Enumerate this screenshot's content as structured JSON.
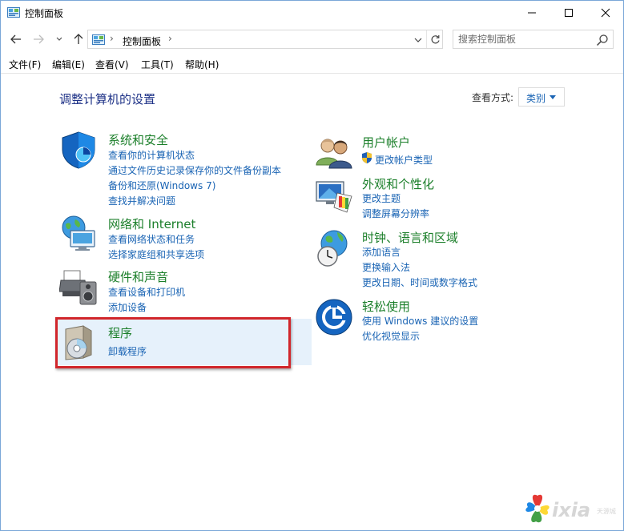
{
  "window": {
    "title": "控制面板"
  },
  "address": {
    "location": "控制面板"
  },
  "search": {
    "placeholder": "搜索控制面板"
  },
  "menu": [
    "文件(F)",
    "编辑(E)",
    "查看(V)",
    "工具(T)",
    "帮助(H)"
  ],
  "content": {
    "heading": "调整计算机的设置",
    "view_by_label": "查看方式:",
    "view_by_value": "类别"
  },
  "categories_left": [
    {
      "title": "系统和安全",
      "icon": "shield-icon",
      "links": [
        "查看你的计算机状态",
        "通过文件历史记录保存你的文件备份副本",
        "备份和还原(Windows 7)",
        "查找并解决问题"
      ]
    },
    {
      "title": "网络和 Internet",
      "icon": "network-globe-icon",
      "links": [
        "查看网络状态和任务",
        "选择家庭组和共享选项"
      ]
    },
    {
      "title": "硬件和声音",
      "icon": "printer-speaker-icon",
      "links": [
        "查看设备和打印机",
        "添加设备"
      ]
    },
    {
      "title": "程序",
      "icon": "programs-disc-icon",
      "links": [
        "卸载程序"
      ]
    }
  ],
  "categories_right": [
    {
      "title": "用户帐户",
      "icon": "users-icon",
      "links": [
        "更改帐户类型"
      ]
    },
    {
      "title": "外观和个性化",
      "icon": "monitor-palette-icon",
      "links": [
        "更改主题",
        "调整屏幕分辨率"
      ]
    },
    {
      "title": "时钟、语言和区域",
      "icon": "globe-clock-icon",
      "links": [
        "添加语言",
        "更换输入法",
        "更改日期、时间或数字格式"
      ]
    },
    {
      "title": "轻松使用",
      "icon": "ease-of-access-icon",
      "links": [
        "使用 Windows 建议的设置",
        "优化视觉显示"
      ]
    }
  ],
  "watermark": {
    "text": "ixia",
    "subtext": "天源城"
  },
  "colors": {
    "title_green": "#1b7f2a",
    "link_blue": "#1a64b4",
    "heading_blue": "#1e3287",
    "highlight_red": "#d1262b",
    "highlight_bg": "#e6f1fb"
  }
}
